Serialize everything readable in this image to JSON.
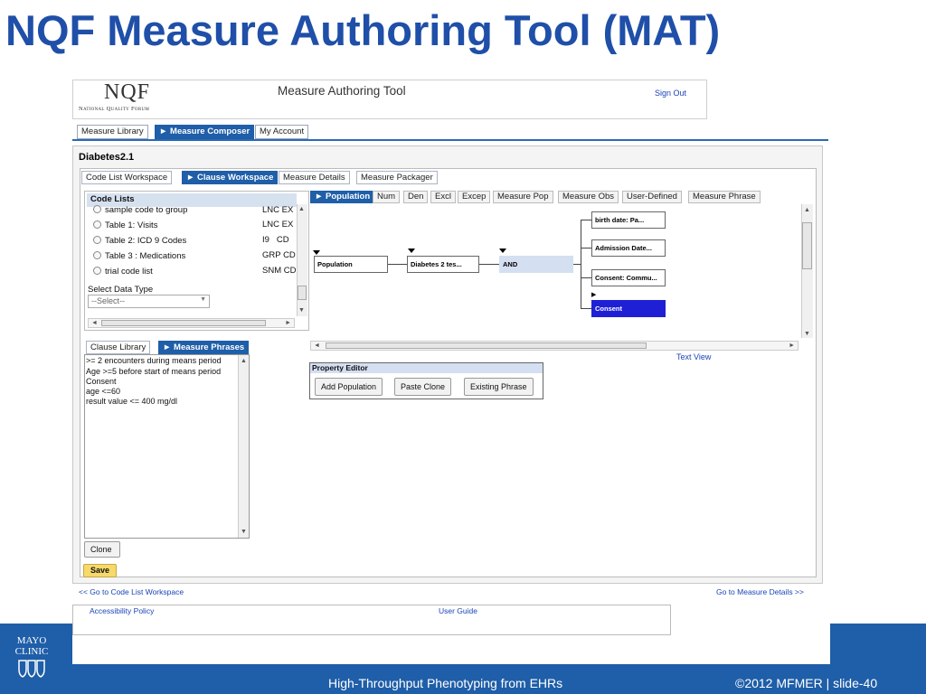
{
  "slide": {
    "title": "NQF Measure Authoring Tool (MAT)",
    "footer_center": "High-Throughput Phenotyping from EHRs",
    "footer_right": "©2012 MFMER  |  slide-40",
    "brand_line1": "MAYO",
    "brand_line2": "CLINIC",
    "colors": {
      "title": "#1f4fa8",
      "bar": "#1f5ea8",
      "link": "#1a44b8"
    }
  },
  "header": {
    "logo": "NQF",
    "logo_sub": "National Quality Forum",
    "app_title": "Measure Authoring Tool",
    "sign_out": "Sign Out"
  },
  "nav": {
    "tabs": [
      "Measure Library",
      "► Measure Composer",
      "My Account"
    ]
  },
  "measure": {
    "name": "Diabetes2.1"
  },
  "subnav": {
    "tabs": [
      "Code List Workspace",
      "► Clause Workspace",
      "Measure Details",
      "Measure Packager"
    ]
  },
  "code_lists": {
    "header": "Code Lists",
    "rows": [
      {
        "name": "sample code to group",
        "code": "LNC",
        "ex": "EX"
      },
      {
        "name": "Table 1: Visits",
        "code": "LNC",
        "ex": "EX"
      },
      {
        "name": "Table 2: ICD 9 Codes",
        "code": "I9",
        "ex": "CD"
      },
      {
        "name": "Table 3 : Medications",
        "code": "GRP",
        "ex": "CD"
      },
      {
        "name": "trial code list",
        "code": "SNM",
        "ex": "CD"
      }
    ],
    "data_type_label": "Select Data Type",
    "data_type_value": "--Select--"
  },
  "population_tabs": [
    "► Population",
    "Num",
    "Den",
    "Excl",
    "Excep",
    "Measure Pop",
    "Measure Obs",
    "User-Defined",
    "Measure Phrase"
  ],
  "tree": {
    "nodes": [
      "Population",
      "Diabetes 2 tes...",
      "AND"
    ],
    "children": [
      "birth date: Pa...",
      "Admission Date...",
      "Consent: Commu...",
      "Consent"
    ]
  },
  "text_view": "Text View",
  "property_editor": {
    "title": "Property Editor",
    "buttons": [
      "Add Population",
      "Paste Clone",
      "Existing Phrase"
    ]
  },
  "library_tabs": [
    "Clause Library",
    "► Measure Phrases"
  ],
  "phrases": [
    ">= 2 encounters during means period",
    "Age >=5 before start of means period",
    "Consent",
    "age <=60",
    "result value <= 400 mg/dl"
  ],
  "actions": {
    "clone": "Clone",
    "save": "Save"
  },
  "links": {
    "go_code": "<< Go to Code List Workspace",
    "go_details": "Go to Measure Details >>",
    "accessibility": "Accessibility Policy",
    "user_guide": "User Guide"
  }
}
